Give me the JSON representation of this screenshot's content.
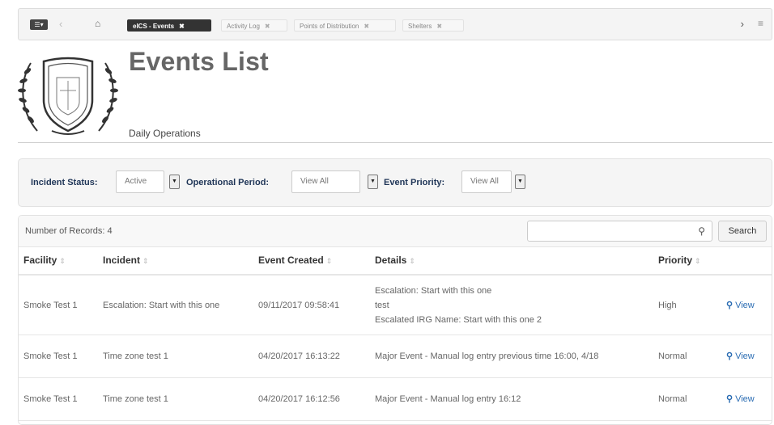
{
  "tabs": [
    {
      "label": "eICS - Events",
      "active": true
    },
    {
      "label": "Activity Log",
      "active": false
    },
    {
      "label": "Points of Distribution",
      "active": false
    },
    {
      "label": "Shelters",
      "active": false
    }
  ],
  "header": {
    "title": "Events List",
    "subtitle": "Daily Operations"
  },
  "filters": {
    "incident_status": {
      "label": "Incident Status:",
      "value": "Active"
    },
    "operational_period": {
      "label": "Operational Period:",
      "value": "View All"
    },
    "event_priority": {
      "label": "Event Priority:",
      "value": "View All"
    }
  },
  "results": {
    "record_count": "Number of Records: 4",
    "search_button": "Search",
    "columns": [
      "Facility",
      "Incident",
      "Event Created",
      "Details",
      "Priority"
    ],
    "rows": [
      {
        "facility": "Smoke Test 1",
        "incident": "Escalation: Start with this one",
        "created": "09/11/2017 09:58:41",
        "details": [
          "Escalation: Start with this one",
          "test",
          "Escalated IRG Name: Start with this one 2"
        ],
        "priority": "High",
        "action": "View"
      },
      {
        "facility": "Smoke Test 1",
        "incident": "Time zone test 1",
        "created": "04/20/2017 16:13:22",
        "details": [
          "Major Event - Manual log entry previous time 16:00, 4/18"
        ],
        "priority": "Normal",
        "action": "View"
      },
      {
        "facility": "Smoke Test 1",
        "incident": "Time zone test 1",
        "created": "04/20/2017 16:12:56",
        "details": [
          "Major Event - Manual log entry 16:12"
        ],
        "priority": "Normal",
        "action": "View"
      }
    ]
  },
  "colors": {
    "label_navy": "#1f3557",
    "link_blue": "#2a6cb3",
    "active_tab": "#333333"
  },
  "icons": [
    "menu-icon",
    "back-arrow-icon",
    "home-icon",
    "tab-close-icon",
    "forward-arrow-icon",
    "list-icon",
    "seal-logo",
    "dropdown-arrow-icon",
    "search-icon",
    "sort-icon",
    "magnifier-icon"
  ]
}
